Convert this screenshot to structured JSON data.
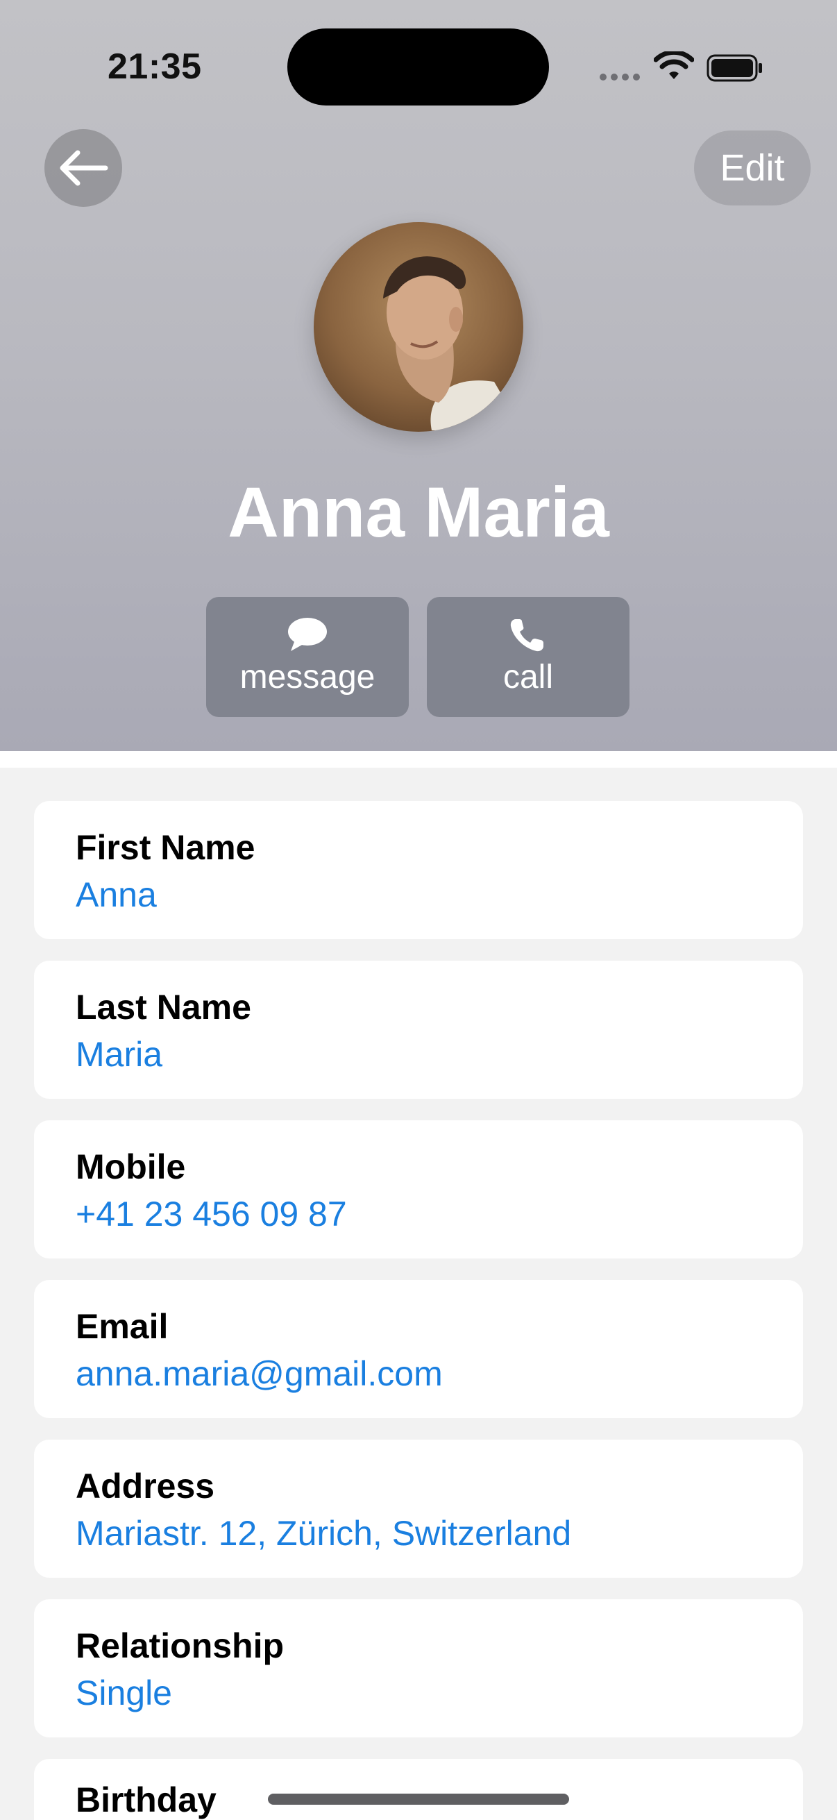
{
  "status_bar": {
    "time": "21:35",
    "icons": [
      "cellular-dots-icon",
      "wifi-icon",
      "battery-icon"
    ]
  },
  "nav": {
    "back_icon": "arrow-left-icon",
    "edit_label": "Edit"
  },
  "contact": {
    "name": "Anna Maria",
    "avatar": "profile-photo"
  },
  "actions": {
    "message": {
      "label": "message",
      "icon": "speech-bubble-icon"
    },
    "call": {
      "label": "call",
      "icon": "phone-icon"
    }
  },
  "fields": [
    {
      "label": "First Name",
      "value": "Anna"
    },
    {
      "label": "Last Name",
      "value": "Maria"
    },
    {
      "label": "Mobile",
      "value": "+41 23 456 09 87"
    },
    {
      "label": "Email",
      "value": "anna.maria@gmail.com"
    },
    {
      "label": "Address",
      "value": "Mariastr. 12, Zürich, Switzerland"
    },
    {
      "label": "Relationship",
      "value": "Single"
    },
    {
      "label": "Birthday",
      "value": ""
    }
  ],
  "colors": {
    "accent": "#1a7fe0",
    "header_top": "#c2c2c6",
    "header_bottom": "#a9a9b5",
    "action_button": "#81848f",
    "background": "#f2f2f2"
  }
}
